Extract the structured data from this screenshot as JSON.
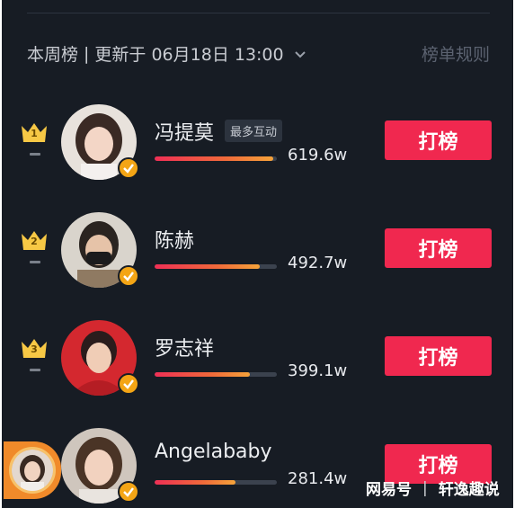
{
  "header": {
    "period": "本周榜",
    "separator": "|",
    "update_text": "更新于 06月18日 13:00",
    "rules_link": "榜单规则"
  },
  "colors": {
    "background": "#171c24",
    "accent": "#f0284f",
    "crown": "#f7c845",
    "badge": "#f4a515"
  },
  "rows": [
    {
      "rank": "1",
      "name": "冯提莫",
      "tag": "最多互动",
      "score": "619.6w",
      "progress": 0.97,
      "button": "打榜",
      "trend_icon": "flat-dash-icon"
    },
    {
      "rank": "2",
      "name": "陈赫",
      "score": "492.7w",
      "progress": 0.86,
      "button": "打榜",
      "trend_icon": "flat-dash-icon"
    },
    {
      "rank": "3",
      "name": "罗志祥",
      "score": "399.1w",
      "progress": 0.78,
      "button": "打榜",
      "trend_icon": "flat-dash-icon"
    },
    {
      "rank": "",
      "name": "Angelababy",
      "score": "281.4w",
      "progress": 0.66,
      "button": "打榜",
      "trend_icon": ""
    }
  ],
  "watermark": {
    "brand": "网易号",
    "separator": "|",
    "author": "轩逸趣说"
  }
}
